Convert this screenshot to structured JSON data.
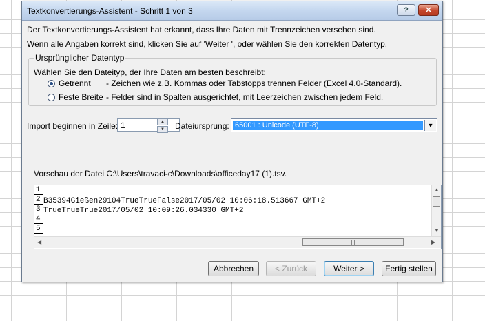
{
  "window": {
    "title": "Textkonvertierungs-Assistent - Schritt 1 von 3",
    "help_label": "?",
    "close_label": "✕"
  },
  "intro": {
    "line1": "Der Textkonvertierungs-Assistent hat erkannt, dass Ihre Daten mit Trennzeichen versehen sind.",
    "line2": "Wenn alle Angaben korrekt sind, klicken Sie auf 'Weiter ', oder wählen Sie den korrekten Datentyp."
  },
  "datatype": {
    "legend": "Ursprünglicher Datentyp",
    "prompt": "Wählen Sie den Dateityp, der Ihre Daten am besten beschreibt:",
    "options": [
      {
        "label": "Getrennt",
        "desc": "- Zeichen wie z.B. Kommas oder Tabstopps trennen Felder (Excel 4.0-Standard).",
        "selected": true
      },
      {
        "label": "Feste Breite",
        "desc": "- Felder sind in Spalten ausgerichtet, mit Leerzeichen zwischen jedem Feld.",
        "selected": false
      }
    ]
  },
  "import": {
    "start_label": "Import beginnen in Zeile:",
    "start_value": "1",
    "origin_label": "Dateiursprung:",
    "origin_value": "65001 : Unicode (UTF-8)"
  },
  "preview": {
    "label": "Vorschau der Datei C:\\Users\\travaci-c\\Downloads\\officeday17 (1).tsv.",
    "rows": [
      {
        "num": "1",
        "text": ""
      },
      {
        "num": "2",
        "text": "B35394Gießen29104TrueTrueFalse2017/05/02 10:06:18.513667 GMT+2"
      },
      {
        "num": "3",
        "text": "TrueTrueTrue2017/05/02 10:09:26.034330 GMT+2"
      },
      {
        "num": "4",
        "text": ""
      },
      {
        "num": "5",
        "text": ""
      }
    ]
  },
  "buttons": {
    "cancel": "Abbrechen",
    "back": "< Zurück",
    "next": "Weiter >",
    "finish": "Fertig stellen"
  }
}
